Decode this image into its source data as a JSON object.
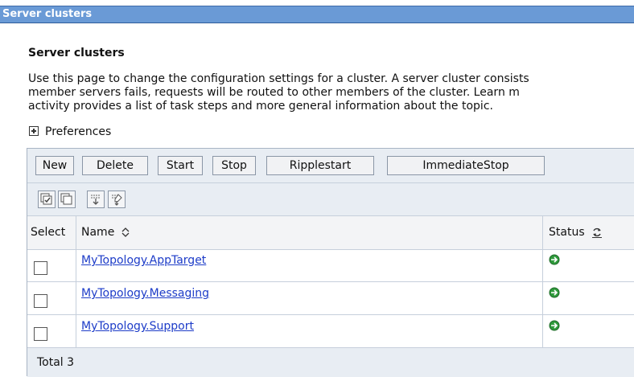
{
  "title_bar": "Server clusters",
  "page": {
    "heading": "Server clusters",
    "description": [
      "Use this page to change the configuration settings for a cluster. A server cluster consists",
      "member servers fails, requests will be routed to other members of the cluster. Learn m",
      "activity provides a list of task steps and more general information about the topic."
    ],
    "preferences_label": "Preferences"
  },
  "toolbar": {
    "new_label": "New",
    "delete_label": "Delete",
    "start_label": "Start",
    "stop_label": "Stop",
    "ripplestart_label": "Ripplestart",
    "immediatestop_label": "ImmediateStop"
  },
  "icon_toolbar": [
    "select-all-icon",
    "deselect-all-icon",
    "show-filter-icon",
    "clear-filter-icon"
  ],
  "table": {
    "columns": {
      "select": "Select",
      "name": "Name",
      "status": "Status"
    },
    "rows": [
      {
        "name": "MyTopology.AppTarget",
        "status": "started-arrow-icon"
      },
      {
        "name": "MyTopology.Messaging",
        "status": "started-arrow-icon"
      },
      {
        "name": "MyTopology.Support",
        "status": "started-arrow-icon"
      }
    ],
    "total_label": "Total 3"
  },
  "colors": {
    "title_bar": "#6a9ad6",
    "link": "#1d3cc8",
    "status_arrow": "#2f9a3c",
    "toolbar_bg": "#e8edf3"
  }
}
